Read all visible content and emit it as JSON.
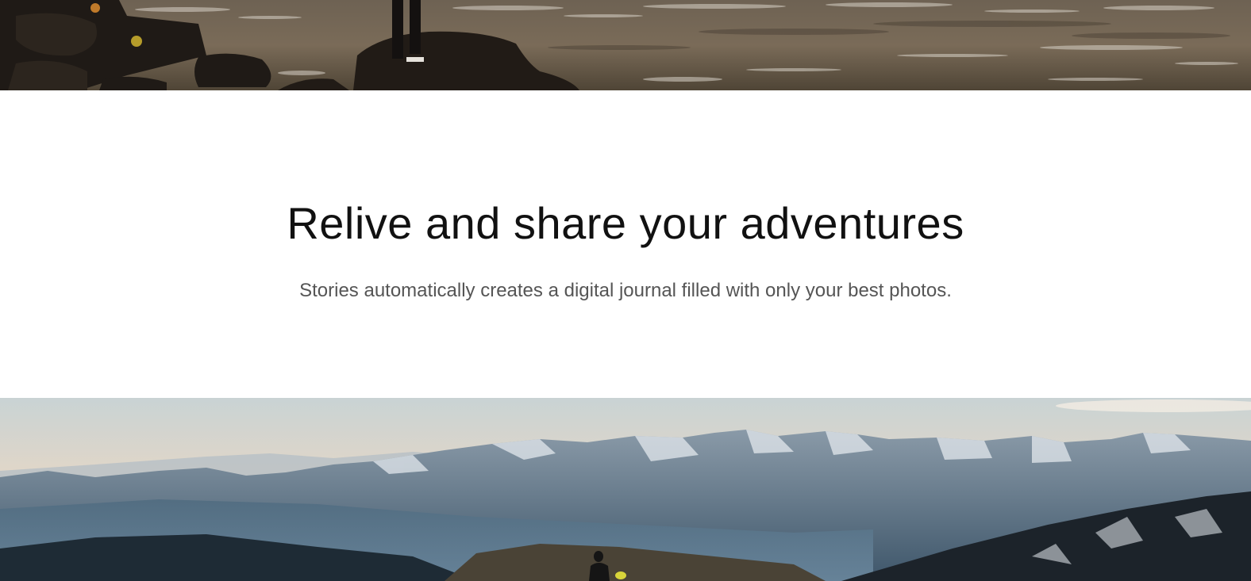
{
  "hero_top": {
    "scene": "rocky-river-shore-photo"
  },
  "intro": {
    "headline": "Relive and share your adventures",
    "subheadline": "Stories automatically creates a digital journal filled with only your best photos."
  },
  "hero_bottom": {
    "scene": "snowy-mountain-range-photo"
  },
  "colors": {
    "headline": "#111111",
    "subheadline": "#555555",
    "background": "#ffffff"
  }
}
